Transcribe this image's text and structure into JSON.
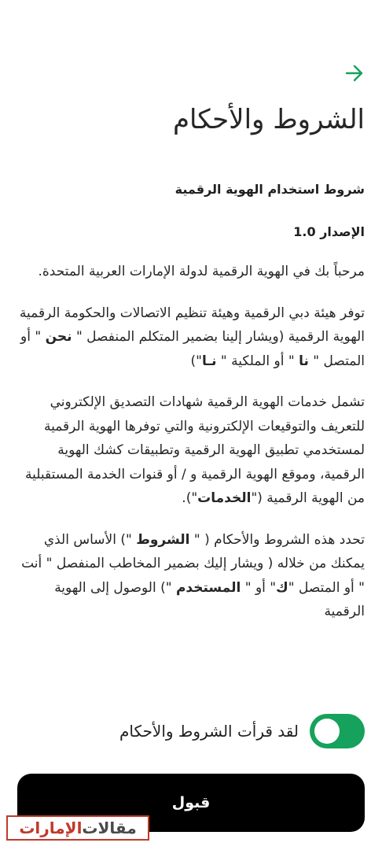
{
  "header": {
    "back_icon": "arrow-right-icon",
    "accent_color": "#16a25c",
    "title": "الشروط والأحكام"
  },
  "terms": {
    "heading": "شروط استخدام الهوية الرقمية",
    "version": "الإصدار 1.0",
    "p1": "مرحباً بك في الهوية الرقمية لدولة الإمارات العربية المتحدة.",
    "p2_a": "توفر هيئة دبي الرقمية وهيئة تنظيم الاتصالات والحكومة الرقمية الهوية الرقمية (ويشار إلينا بضمير المتكلم المنفصل \" ",
    "p2_b1": "نحن",
    "p2_c": " \" أو المتصل \" ",
    "p2_b2": "نا",
    "p2_d": " \" أو الملكية \" ",
    "p2_b3": "نـا",
    "p2_e": "\")",
    "p3_a": "تشمل خدمات الهوية الرقمية شهادات التصديق الإلكتروني للتعريف والتوقيعات الإلكترونية والتي توفرها الهوية الرقمية لمستخدمي تطبيق الهوية الرقمية وتطبيقات كشك الهوية الرقمية، وموقع الهوية الرقمية و / أو قنوات الخدمة المستقبلية من الهوية الرقمية (\"",
    "p3_b": "الخدمات",
    "p3_c": "\").",
    "p4_a": "تحدد هذه الشروط والأحكام ( \" ",
    "p4_b1": "الشروط",
    "p4_c": " \") الأساس الذي يمكنك من خلاله ( ويشار إليك بضمير المخاطب المنفصل \" أنت \" أو المتصل \"",
    "p4_b2": "ك",
    "p4_d": "\" أو \" ",
    "p4_b3": "المستخدم",
    "p4_e": " \") الوصول إلى الهوية الرقمية"
  },
  "consent": {
    "label": "لقد قرأت الشروط والأحكام",
    "toggle_on": true,
    "toggle_color": "#16a25c"
  },
  "actions": {
    "accept_label": "قبول"
  },
  "watermark": {
    "part1": "مقالات ",
    "part2": "الإمارات"
  }
}
